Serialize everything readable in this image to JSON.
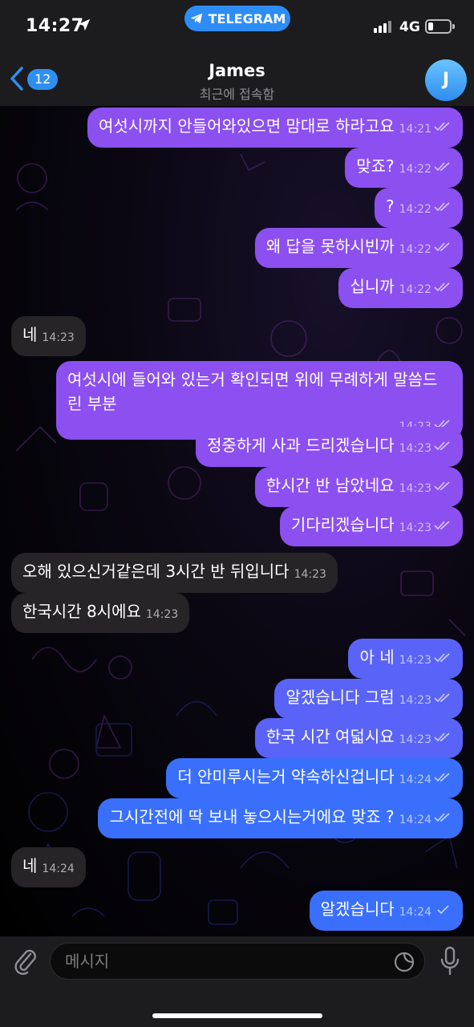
{
  "status_bar": {
    "time": "14:27",
    "app_pill": "TELEGRAM",
    "network": "4G"
  },
  "header": {
    "back_count": "12",
    "title": "James",
    "subtitle": "최근에 접속함",
    "avatar_letter": "J"
  },
  "messages": [
    {
      "dir": "out",
      "text": "여섯시까지 안들어와있으면 맘대로 하라고요",
      "time": "14:21",
      "read": true
    },
    {
      "dir": "out",
      "text": "맞죠?",
      "time": "14:22",
      "read": true
    },
    {
      "dir": "out",
      "text": "?",
      "time": "14:22",
      "read": true
    },
    {
      "dir": "out",
      "text": "왜 답을 못하시빈까",
      "time": "14:22",
      "read": true
    },
    {
      "dir": "out",
      "text": "십니까",
      "time": "14:22",
      "read": true
    },
    {
      "dir": "in",
      "text": "네",
      "time": "14:23"
    },
    {
      "dir": "out",
      "text": "여섯시에 들어와 있는거 확인되면 위에 무례하게 말씀드린 부분",
      "time": "14:23",
      "read": true
    },
    {
      "dir": "out",
      "text": "정중하게 사과 드리겠습니다",
      "time": "14:23",
      "read": true
    },
    {
      "dir": "out",
      "text": "한시간 반 남았네요",
      "time": "14:23",
      "read": true
    },
    {
      "dir": "out",
      "text": "기다리겠습니다",
      "time": "14:23",
      "read": true
    },
    {
      "dir": "in",
      "text": "오해 있으신거같은데 3시간 반 뒤입니다",
      "time": "14:23"
    },
    {
      "dir": "in",
      "text": "한국시간 8시에요",
      "time": "14:23"
    },
    {
      "dir": "out",
      "text": "아 네",
      "time": "14:23",
      "read": true
    },
    {
      "dir": "out",
      "text": "알겠습니다 그럼",
      "time": "14:23",
      "read": true
    },
    {
      "dir": "out",
      "text": "한국 시간 여덟시요",
      "time": "14:23",
      "read": true
    },
    {
      "dir": "out",
      "text": "더 안미루시는거 약속하신겁니다",
      "time": "14:24",
      "read": true
    },
    {
      "dir": "out",
      "text": "그시간전에 딱 보내 놓으시는거에요 맞죠 ?",
      "time": "14:24",
      "read": true
    },
    {
      "dir": "in",
      "text": "네",
      "time": "14:24"
    },
    {
      "dir": "out",
      "text": "알겠습니다",
      "time": "14:24",
      "read": false
    }
  ],
  "input": {
    "placeholder": "메시지"
  },
  "colors": {
    "outgoing_bubble": "#8c4ff0",
    "outgoing_bubble_blue": "#3a6ffc",
    "incoming_bubble": "#262427",
    "accent": "#2f8ff0"
  }
}
